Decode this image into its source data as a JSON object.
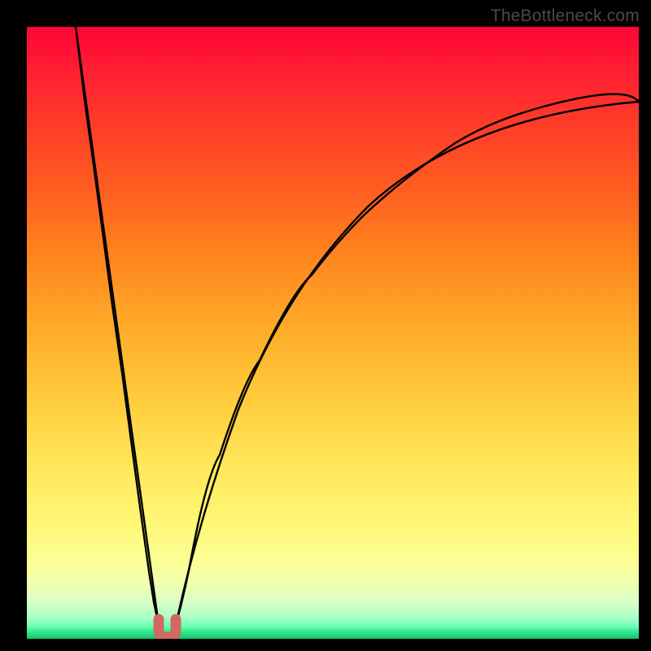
{
  "watermark": {
    "text": "TheBottleneck.com"
  },
  "colors": {
    "frame": "#000000",
    "curve_stroke": "#000000",
    "marker_fill": "#d06a60",
    "watermark_text": "#4a4a4a"
  },
  "chart_data": {
    "type": "line",
    "title": "",
    "xlabel": "",
    "ylabel": "",
    "xlim": [
      0,
      100
    ],
    "ylim": [
      0,
      100
    ],
    "grid": false,
    "legend": false,
    "series": [
      {
        "name": "left-branch",
        "x": [
          8.0,
          9.5,
          11.0,
          12.5,
          14.0,
          15.5,
          17.0,
          18.5,
          20.0,
          20.8,
          21.6
        ],
        "y": [
          100.0,
          88.0,
          76.5,
          65.5,
          54.5,
          43.5,
          32.5,
          21.5,
          11.0,
          6.0,
          2.3
        ]
      },
      {
        "name": "right-branch",
        "x": [
          24.4,
          25.5,
          27.0,
          29.0,
          31.5,
          34.5,
          38.0,
          42.0,
          46.5,
          51.5,
          57.0,
          63.0,
          70.0,
          78.0,
          87.0,
          97.0,
          100.0
        ],
        "y": [
          2.3,
          7.0,
          14.0,
          22.0,
          30.0,
          38.0,
          45.5,
          52.5,
          59.0,
          64.5,
          69.5,
          74.0,
          78.0,
          81.5,
          84.5,
          87.0,
          87.7
        ]
      }
    ],
    "minimum_marker": {
      "x": 23.0,
      "y": 1.3,
      "width_pct": 2.8
    },
    "background_gradient": {
      "direction": "vertical",
      "stops": [
        {
          "pos": 0.0,
          "color": "#ff0438"
        },
        {
          "pos": 0.5,
          "color": "#ffad2a"
        },
        {
          "pos": 0.87,
          "color": "#fcff92"
        },
        {
          "pos": 1.0,
          "color": "#14c16c"
        }
      ]
    }
  }
}
